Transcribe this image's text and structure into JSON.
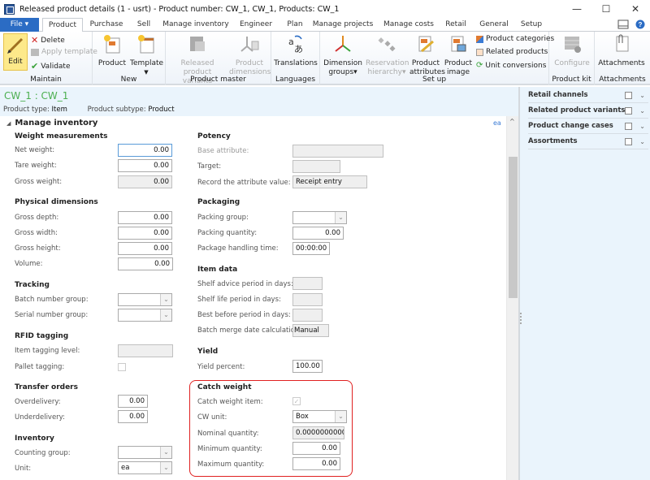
{
  "window": {
    "title": "Released product details (1 - usrt) - Product number: CW_1, CW_1, Products: CW_1",
    "minimize": "—",
    "maximize": "☐",
    "close": "✕"
  },
  "tabs": [
    {
      "label": "File ▾"
    },
    {
      "label": "Product"
    },
    {
      "label": "Purchase"
    },
    {
      "label": "Sell"
    },
    {
      "label": "Manage inventory"
    },
    {
      "label": "Engineer"
    },
    {
      "label": "Plan"
    },
    {
      "label": "Manage projects"
    },
    {
      "label": "Manage costs"
    },
    {
      "label": "Retail"
    },
    {
      "label": "General"
    },
    {
      "label": "Setup"
    }
  ],
  "ribbon": {
    "maintain": {
      "label": "Maintain",
      "edit": "Edit",
      "delete": "Delete",
      "apply_template": "Apply template",
      "validate": "Validate"
    },
    "new": {
      "label": "New",
      "product": "Product",
      "template": "Template"
    },
    "product_master": {
      "label": "Product master",
      "released_variants_1": "Released product",
      "released_variants_2": "variants",
      "product_dimensions_1": "Product",
      "product_dimensions_2": "dimensions"
    },
    "languages": {
      "label": "Languages",
      "translations": "Translations"
    },
    "set_up": {
      "label": "Set up",
      "dimension_groups_1": "Dimension",
      "dimension_groups_2": "groups▾",
      "reservation_1": "Reservation",
      "reservation_2": "hierarchy▾",
      "attributes_1": "Product",
      "attributes_2": "attributes",
      "image_1": "Product",
      "image_2": "image",
      "categories": "Product categories",
      "related": "Related products",
      "unit_conversions": "Unit conversions"
    },
    "product_kit": {
      "label": "Product kit",
      "configure": "Configure"
    },
    "attachments": {
      "label": "Attachments",
      "attachments": "Attachments"
    }
  },
  "record": {
    "title": "CW_1 : CW_1",
    "type_label": "Product type:",
    "type_value": "Item",
    "subtype_label": "Product subtype:",
    "subtype_value": "Product"
  },
  "section": {
    "title": "Manage inventory",
    "unit_link": "ea"
  },
  "left": {
    "weight": {
      "title": "Weight measurements",
      "net_label": "Net weight:",
      "net": "0.00",
      "tare_label": "Tare weight:",
      "tare": "0.00",
      "gross_label": "Gross weight:",
      "gross": "0.00"
    },
    "physical": {
      "title": "Physical dimensions",
      "depth_label": "Gross depth:",
      "depth": "0.00",
      "width_label": "Gross width:",
      "width": "0.00",
      "height_label": "Gross height:",
      "height": "0.00",
      "volume_label": "Volume:",
      "volume": "0.00"
    },
    "tracking": {
      "title": "Tracking",
      "batch_label": "Batch number group:",
      "batch": "",
      "serial_label": "Serial number group:",
      "serial": ""
    },
    "rfid": {
      "title": "RFID tagging",
      "item_label": "Item tagging level:",
      "item": "",
      "pallet_label": "Pallet tagging:"
    },
    "transfer": {
      "title": "Transfer orders",
      "over_label": "Overdelivery:",
      "over": "0.00",
      "under_label": "Underdelivery:",
      "under": "0.00"
    },
    "inventory": {
      "title": "Inventory",
      "counting_label": "Counting group:",
      "counting": "",
      "unit_label": "Unit:",
      "unit": "ea"
    }
  },
  "right": {
    "potency": {
      "title": "Potency",
      "base_label": "Base attribute:",
      "base": "",
      "target_label": "Target:",
      "target": "",
      "record_label": "Record the attribute value:",
      "record": "Receipt entry"
    },
    "packaging": {
      "title": "Packaging",
      "group_label": "Packing group:",
      "group": "",
      "qty_label": "Packing quantity:",
      "qty": "0.00",
      "time_label": "Package handling time:",
      "time": "00:00:00"
    },
    "item_data": {
      "title": "Item data",
      "advice_label": "Shelf advice period in days:",
      "life_label": "Shelf life period in days:",
      "best_label": "Best before period in days:",
      "batch_label": "Batch merge date calculation:",
      "batch": "Manual"
    },
    "yield": {
      "title": "Yield",
      "percent_label": "Yield percent:",
      "percent": "100.00"
    },
    "catch_weight": {
      "title": "Catch weight",
      "item_label": "Catch weight item:",
      "item_checked": true,
      "unit_label": "CW unit:",
      "unit": "Box",
      "nominal_label": "Nominal quantity:",
      "nominal": "0.0000000000",
      "min_label": "Minimum quantity:",
      "min": "0.00",
      "max_label": "Maximum quantity:",
      "max": "0.00"
    }
  },
  "factbox": [
    {
      "label": "Retail channels"
    },
    {
      "label": "Related product variants"
    },
    {
      "label": "Product change cases"
    },
    {
      "label": "Assortments"
    }
  ]
}
